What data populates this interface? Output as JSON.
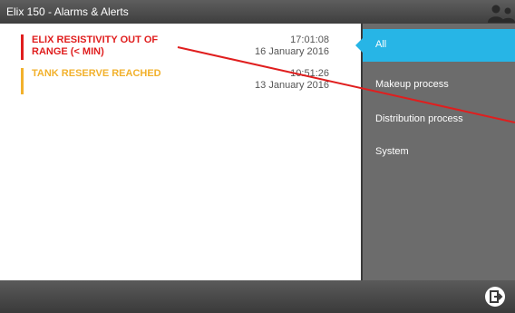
{
  "header": {
    "title": "Elix 150 - Alarms & Alerts",
    "user_icon": "user-icon"
  },
  "alarms": [
    {
      "message": "ELIX RESISTIVITY OUT OF RANGE (< MIN)",
      "time": "17:01:08",
      "date": "16 January 2016",
      "color": "#e01e1e"
    },
    {
      "message": "TANK RESERVE REACHED",
      "time": "10:51:26",
      "date": "13 January 2016",
      "color": "#f2b12c"
    }
  ],
  "sidebar": {
    "items": [
      {
        "label": "All",
        "active": true
      },
      {
        "label": "Makeup process"
      },
      {
        "label": "Distribution process"
      },
      {
        "label": "System"
      }
    ]
  },
  "footer": {
    "exit_icon": "exit-icon"
  },
  "colors": {
    "accent": "#27b5e6",
    "alarm": "#e01e1e",
    "alert": "#f2b12c",
    "annotation_line": "#e01e1e"
  }
}
